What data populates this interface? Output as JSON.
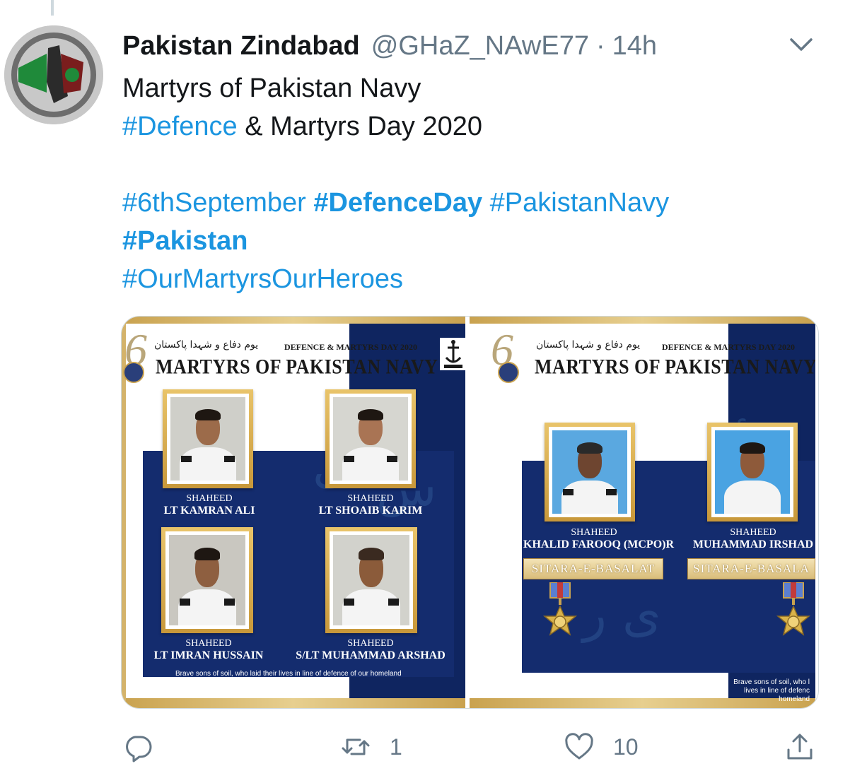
{
  "tweet": {
    "display_name": "Pakistan Zindabad",
    "handle": "@GHaZ_NAwE77",
    "separator": "·",
    "timestamp": "14h",
    "text_lines": [
      {
        "id": "line1",
        "parts": [
          {
            "text": "Martyrs of Pakistan Navy",
            "type": "text"
          }
        ]
      },
      {
        "id": "line2",
        "parts": [
          {
            "text": "#Defence",
            "type": "hashtag"
          },
          {
            "text": " & Martyrs Day 2020",
            "type": "text"
          }
        ]
      }
    ],
    "hashtags_block": {
      "line3": {
        "a": "#6thSeptember",
        "b": "#DefenceDay",
        "c": "#PakistanNavy"
      },
      "line4": "#Pakistan",
      "line5": "#OurMartyrsOurHeroes"
    }
  },
  "media": {
    "left": {
      "urdu_heading": "یوم دفاع و شہدا پاکستان",
      "event_label": "DEFENCE & MARTYRS DAY 2020",
      "title": "MARTYRS OF PAKISTAN NAVY",
      "martyrs": [
        {
          "prefix": "SHAHEED",
          "name": "LT KAMRAN ALI"
        },
        {
          "prefix": "SHAHEED",
          "name": "LT SHOAIB KARIM"
        },
        {
          "prefix": "SHAHEED",
          "name": "LT IMRAN HUSSAIN"
        },
        {
          "prefix": "SHAHEED",
          "name": "S/LT MUHAMMAD ARSHAD"
        }
      ],
      "footer": "Brave sons of soil, who laid their lives in line of defence of our homeland"
    },
    "right": {
      "urdu_heading": "یوم دفاع و شہدا پاکستان",
      "event_label": "DEFENCE & MARTYRS DAY 2020",
      "title": "MARTYRS OF PAKISTAN NAVY",
      "martyrs": [
        {
          "prefix": "SHAHEED",
          "name": "KHALID FAROOQ (MCPO)R",
          "award": "SITARA-E-BASALAT"
        },
        {
          "prefix": "SHAHEED",
          "name": "MUHAMMAD IRSHAD",
          "award": "SITARA-E-BASALA"
        }
      ],
      "footer_lines": [
        "Brave sons of soil, who l",
        "lives in line of defenc",
        "homeland"
      ]
    }
  },
  "actions": {
    "reply_count": "",
    "retweet_count": "1",
    "like_count": "10"
  },
  "colors": {
    "link": "#1b95e0",
    "muted": "#657786",
    "navy": "#0f2560",
    "gold": "#c9a24f"
  },
  "icons": [
    "chevron-down-icon",
    "reply-icon",
    "retweet-icon",
    "like-icon",
    "share-icon"
  ]
}
